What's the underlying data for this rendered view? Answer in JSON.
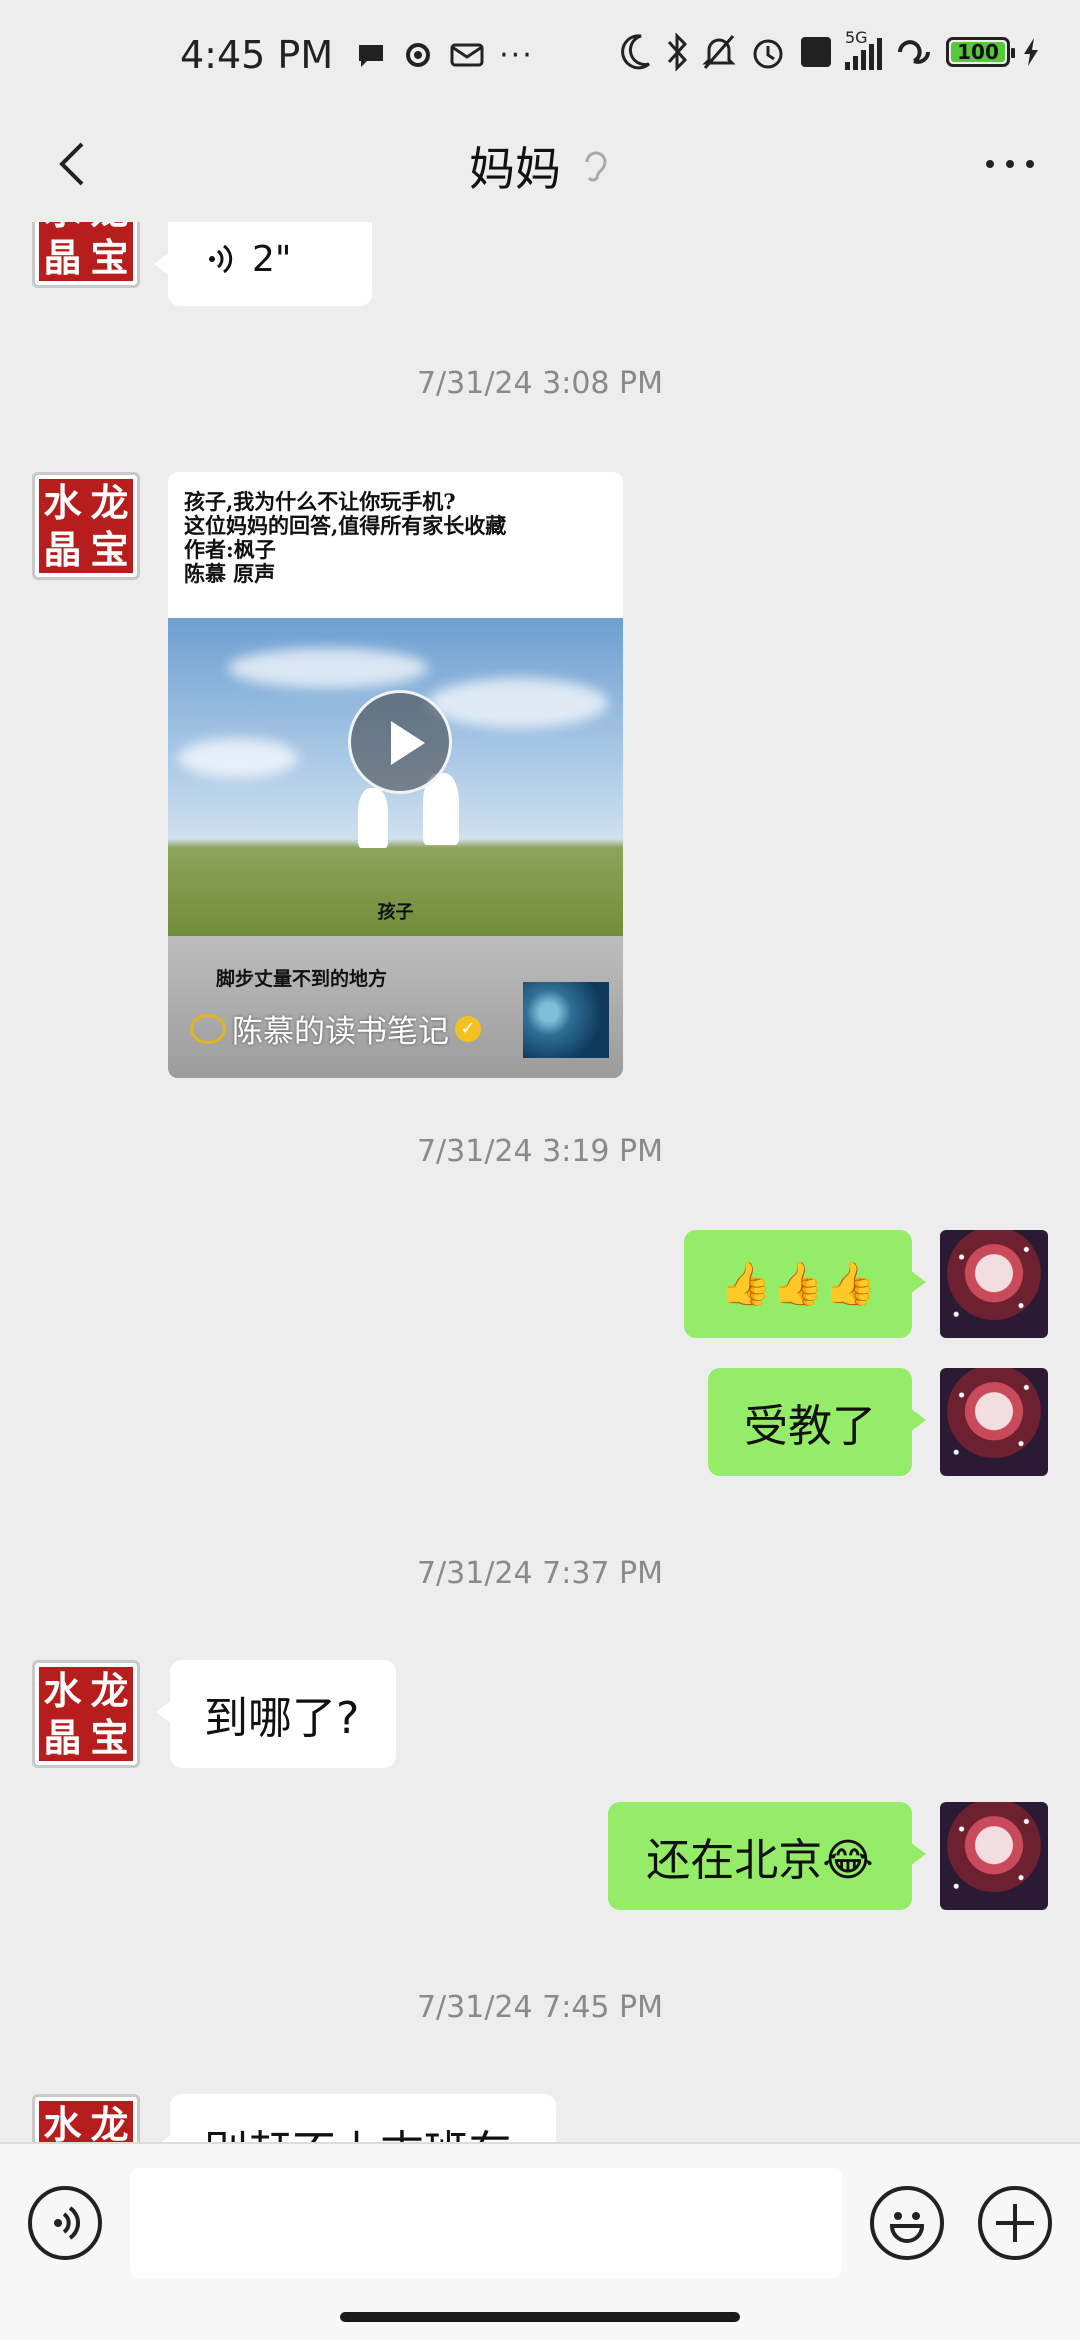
{
  "status_bar": {
    "time": "4:45 PM",
    "more": "···",
    "network": "5G",
    "battery": "100"
  },
  "header": {
    "title": "妈妈"
  },
  "messages": {
    "voice_duration": "2\"",
    "ts1": "7/31/24 3:08 PM",
    "video_card": {
      "text": "孩子,我为什么不让你玩手机?\n这位妈妈的回答,值得所有家长收藏\n作者:枫子\n陈慕 原声",
      "image_caption": "孩子",
      "slogan": "脚步丈量不到的地方",
      "account": "陈慕的读书笔记"
    },
    "ts2": "7/31/24 3:19 PM",
    "thumbs": "👍👍👍",
    "shoujiao": "受教了",
    "ts3": "7/31/24 7:37 PM",
    "where": "到哪了?",
    "still_beijing": "还在北京😂",
    "ts4": "7/31/24 7:45 PM",
    "last_partial": "别赶不上末班车"
  },
  "avatar_text": [
    "水",
    "龙",
    "晶",
    "宝"
  ]
}
